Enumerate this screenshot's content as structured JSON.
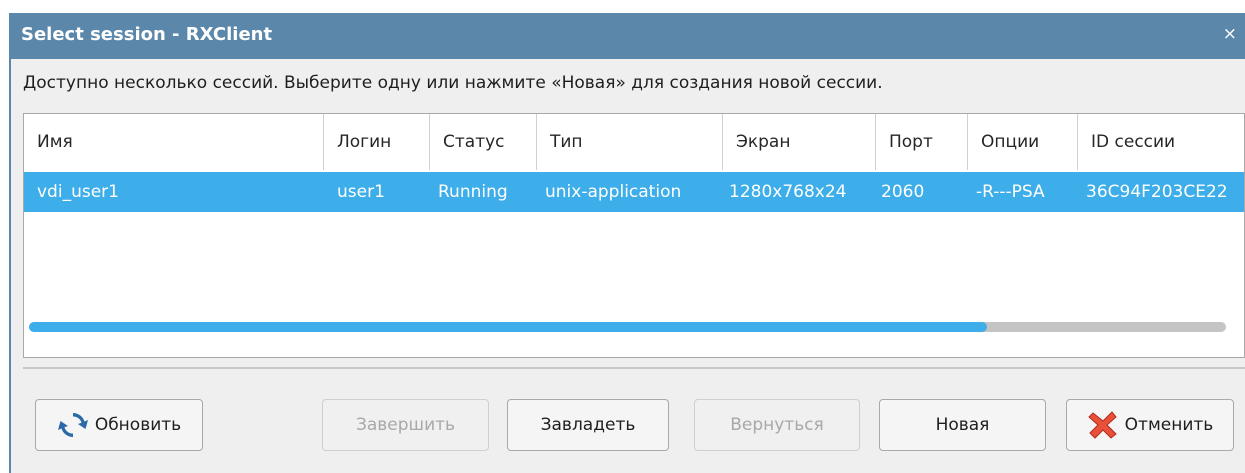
{
  "window": {
    "title": "Select session - RXClient",
    "close_glyph": "×"
  },
  "message": "Доступно несколько сессий. Выберите одну или нажмите «Новая» для создания новой сессии.",
  "table": {
    "columns": [
      "Имя",
      "Логин",
      "Статус",
      "Тип",
      "Экран",
      "Порт",
      "Опции",
      "ID сессии"
    ],
    "rows": [
      [
        "vdi_user1",
        "user1",
        "Running",
        "unix-application",
        "1280x768x24",
        "2060",
        "-R---PSA",
        "36C94F203CE22"
      ]
    ],
    "selected_row": 0
  },
  "scrollbar": {
    "position_fraction": 0.8
  },
  "buttons": {
    "refresh": {
      "label": "Обновить",
      "icon": "refresh-icon"
    },
    "terminate": {
      "label": "Завершить"
    },
    "takeover": {
      "label": "Завладеть"
    },
    "resume": {
      "label": "Вернуться"
    },
    "new": {
      "label": "Новая"
    },
    "cancel": {
      "label": "Отменить",
      "icon": "cancel-icon"
    }
  },
  "colors": {
    "titlebar": "#5a87aa",
    "selection": "#3daee9",
    "dialog_bg": "#efefef"
  }
}
